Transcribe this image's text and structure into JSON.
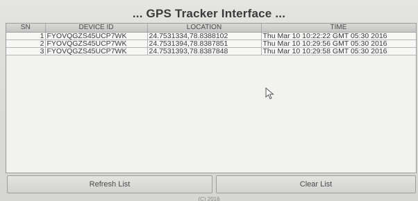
{
  "window": {
    "title": "... GPS Tracker Interface ..."
  },
  "table": {
    "columns": [
      "SN",
      "DEVICE ID",
      "LOCATION",
      "TIME"
    ],
    "rows": [
      {
        "sn": "1",
        "device_id": "FYOVQGZS45UCP7WK",
        "location": "24.7531334,78.8388102",
        "time": "Thu Mar 10 10:22:22 GMT 05:30 2016"
      },
      {
        "sn": "2",
        "device_id": "FYOVQGZS45UCP7WK",
        "location": "24.7531394,78.8387851",
        "time": "Thu Mar 10 10:29:56 GMT 05:30 2016"
      },
      {
        "sn": "3",
        "device_id": "FYOVQGZS45UCP7WK",
        "location": "24.7531393,78.8387848",
        "time": "Thu Mar 10 10:29:58 GMT 05:30 2016"
      }
    ]
  },
  "buttons": {
    "refresh": "Refresh List",
    "clear": "Clear List"
  },
  "footer": {
    "text": "(C) 2016"
  },
  "icons": {
    "cursor": "mouse-pointer-icon"
  }
}
